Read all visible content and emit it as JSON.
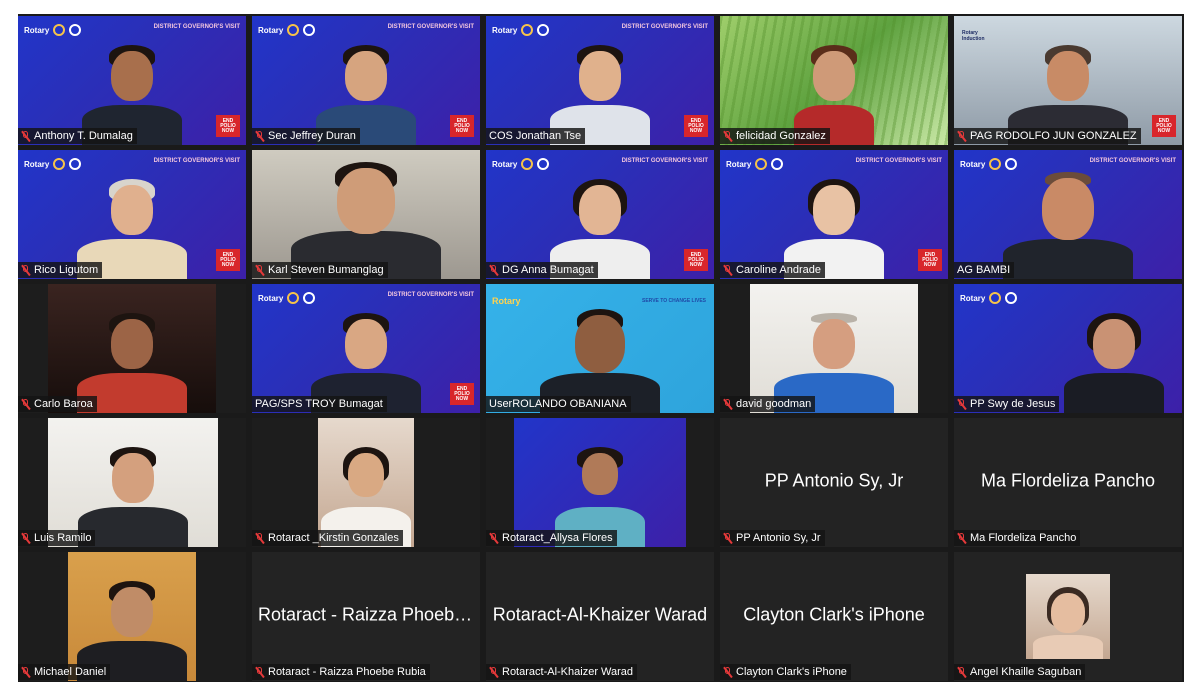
{
  "participants": [
    {
      "name": "Anthony T. Dumalag"
    },
    {
      "name": "Sec Jeffrey Duran"
    },
    {
      "name": "COS Jonathan Tse"
    },
    {
      "name": "felicidad Gonzalez"
    },
    {
      "name": "PAG RODOLFO JUN GONZALEZ"
    },
    {
      "name": "Rico Ligutom"
    },
    {
      "name": "Karl Steven Bumanglag"
    },
    {
      "name": "DG Anna Bumagat"
    },
    {
      "name": "Caroline Andrade"
    },
    {
      "name": "AG BAMBI"
    },
    {
      "name": "Carlo Baroa"
    },
    {
      "name": "PAG/SPS TROY Bumagat"
    },
    {
      "name": "UserROLANDO OBANIANA"
    },
    {
      "name": "david goodman"
    },
    {
      "name": "PP Swy de Jesus"
    },
    {
      "name": "Luis Ramilo"
    },
    {
      "name": "Rotaract _Kirstin Gonzales"
    },
    {
      "name": "Rotaract_Allysa Flores"
    },
    {
      "name": "PP Antonio Sy, Jr",
      "display": "PP Antonio Sy, Jr"
    },
    {
      "name": "Ma Flordeliza Pancho",
      "display": "Ma Flordeliza Pancho"
    },
    {
      "name": "Michael Daniel"
    },
    {
      "name": "Rotaract - Raizza Phoebe Rubia",
      "display": "Rotaract - Raizza Phoebe..."
    },
    {
      "name": "Rotaract-Al-Khaizer Warad",
      "display": "Rotaract-Al-Khaizer Warad"
    },
    {
      "name": "Clayton Clark's iPhone",
      "display": "Clayton Clark's iPhone"
    },
    {
      "name": "Angel Khaille Saguban"
    }
  ],
  "branding": {
    "rotary": "Rotary",
    "serve": "SERVE TO CHANGE LIVES",
    "visit": "DISTRICT GOVERNOR'S VISIT",
    "endpolio": "END POLIO NOW"
  },
  "colors": {
    "gallery_bg": "#1a1a1a",
    "brand_blue": "#2135c9",
    "mic_muted": "#e5393a"
  }
}
